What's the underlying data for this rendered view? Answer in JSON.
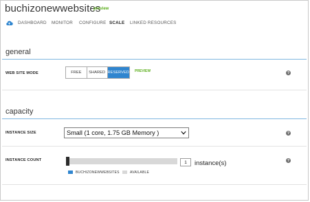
{
  "header": {
    "site_name": "buchizonewwebsites",
    "preview_badge": "preview",
    "icon": "cloud-icon"
  },
  "nav": {
    "items": [
      {
        "label": "DASHBOARD",
        "active": false
      },
      {
        "label": "MONITOR",
        "active": false
      },
      {
        "label": "CONFIGURE",
        "active": false
      },
      {
        "label": "SCALE",
        "active": true
      },
      {
        "label": "LINKED RESOURCES",
        "active": false
      }
    ]
  },
  "general": {
    "heading": "general",
    "web_site_mode": {
      "label": "WEB SITE MODE",
      "options": [
        "FREE",
        "SHARED",
        "RESERVED"
      ],
      "selected": "RESERVED",
      "preview_label": "PREVIEW"
    }
  },
  "capacity": {
    "heading": "capacity",
    "instance_size": {
      "label": "INSTANCE SIZE",
      "value": "Small (1 core, 1.75 GB Memory )"
    },
    "instance_count": {
      "label": "INSTANCE COUNT",
      "value": "1",
      "unit": "instance(s)",
      "legend": [
        {
          "label": "BUCHIZONEWWEBSITES",
          "color": "#2f85cf"
        },
        {
          "label": "AVAILABLE",
          "color": "#d8d8d8"
        }
      ]
    }
  },
  "help": {
    "glyph": "?"
  },
  "colors": {
    "accent": "#2f85cf",
    "preview_green": "#5bae1c",
    "section_rule": "#7fb6e0"
  }
}
